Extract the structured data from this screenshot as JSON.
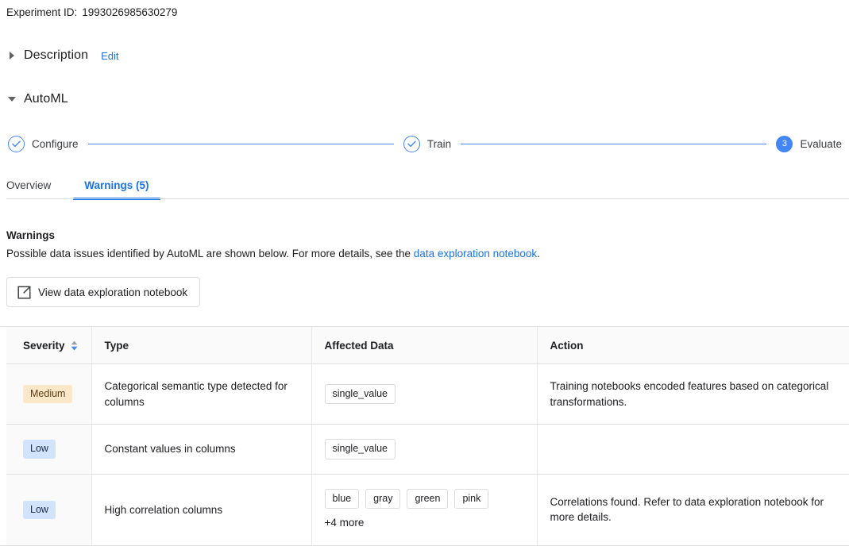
{
  "experiment": {
    "id_label": "Experiment ID:",
    "id_value": "1993026985630279"
  },
  "sections": {
    "description": {
      "title": "Description",
      "edit_label": "Edit",
      "expanded": false,
      "caret_icon": "caret-right-icon"
    },
    "automl": {
      "title": "AutoML",
      "expanded": true,
      "caret_icon": "caret-down-icon"
    }
  },
  "stepper": {
    "steps": [
      {
        "label": "Configure",
        "state": "done",
        "marker": "check-icon"
      },
      {
        "label": "Train",
        "state": "done",
        "marker": "check-icon"
      },
      {
        "label": "Evaluate",
        "state": "active",
        "marker": "3"
      }
    ],
    "accent_color": "#4285f4"
  },
  "tabs": [
    {
      "label": "Overview",
      "active": false
    },
    {
      "label": "Warnings (5)",
      "active": true
    }
  ],
  "warnings_panel": {
    "heading": "Warnings",
    "description_prefix": "Possible data issues identified by AutoML are shown below. For more details, see the ",
    "description_link": "data exploration notebook",
    "description_suffix": ".",
    "notebook_button": {
      "label": "View data exploration notebook",
      "icon": "external-link-icon"
    }
  },
  "table": {
    "columns": [
      {
        "key": "severity",
        "label": "Severity",
        "sortable": true,
        "sort_direction": "desc"
      },
      {
        "key": "type",
        "label": "Type",
        "sortable": false
      },
      {
        "key": "affected_data",
        "label": "Affected Data",
        "sortable": false
      },
      {
        "key": "action",
        "label": "Action",
        "sortable": false
      }
    ],
    "rows": [
      {
        "severity": "Medium",
        "severity_level": "medium",
        "type": "Categorical semantic type detected for columns",
        "affected_data": [
          "single_value"
        ],
        "affected_more": "",
        "action": "Training notebooks encoded features based on categorical transformations."
      },
      {
        "severity": "Low",
        "severity_level": "low",
        "type": "Constant values in columns",
        "affected_data": [
          "single_value"
        ],
        "affected_more": "",
        "action": ""
      },
      {
        "severity": "Low",
        "severity_level": "low",
        "type": "High correlation columns",
        "affected_data": [
          "blue",
          "gray",
          "green",
          "pink"
        ],
        "affected_more": "+4 more",
        "action": "Correlations found. Refer to data exploration notebook for more details."
      }
    ]
  },
  "colors": {
    "link": "#1a73e8",
    "accent": "#4285f4",
    "badge_medium_bg": "#fce8c8",
    "badge_medium_fg": "#5b3b17",
    "badge_low_bg": "#d2e3fc",
    "badge_low_fg": "#1c2c52",
    "border": "#e0e0e0",
    "header_bg": "#fafafa"
  }
}
